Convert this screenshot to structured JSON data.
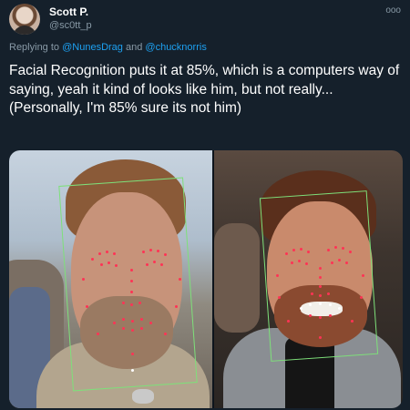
{
  "author": {
    "display_name": "Scott P.",
    "handle": "@sc0tt_p",
    "avatar_icon": "user-avatar-photo"
  },
  "more_icon": "ellipsis-icon",
  "more_label": "ooo",
  "reply": {
    "prefix": "Replying to",
    "mention_1": "@NunesDrag",
    "conjunction": "and",
    "mention_2": "@chucknorris"
  },
  "tweet": {
    "line_1": "Facial Recognition puts it at 85%, which is a computers way of saying, yeah it kind of looks like him, but not really...",
    "line_2": "(Personally, I'm 85% sure its not him)"
  },
  "media": {
    "left_photo_icon": "face-recognition-photo-left",
    "right_photo_icon": "face-recognition-photo-right"
  },
  "colors": {
    "background": "#15202b",
    "link": "#1da1f2",
    "secondary_text": "#8899a6",
    "detection_box": "#7ee07a",
    "landmark_dot": "#ff3355"
  }
}
